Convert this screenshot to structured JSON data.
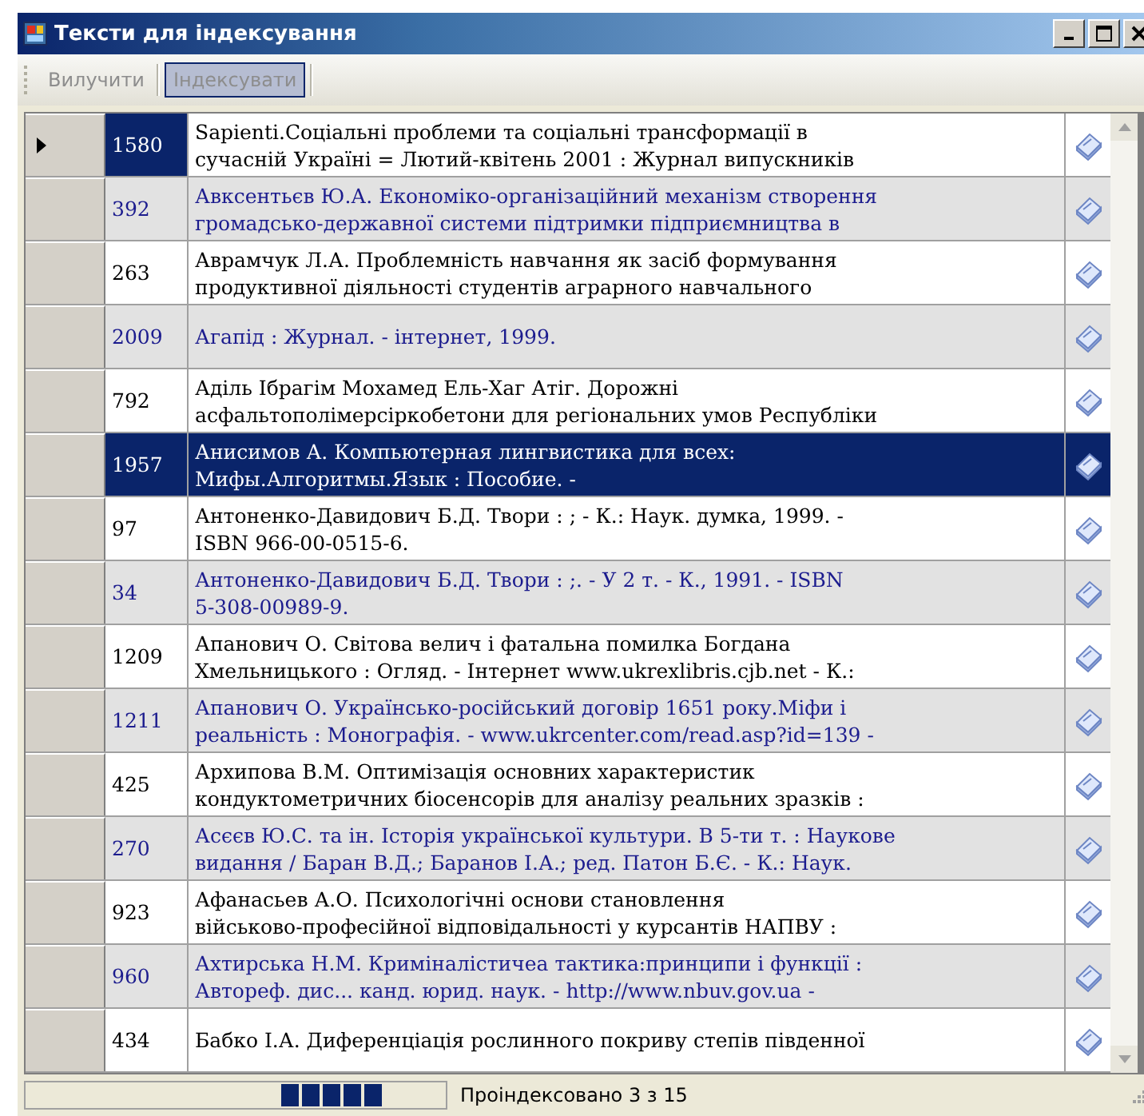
{
  "window": {
    "title": "Тексти для індексування"
  },
  "toolbar": {
    "buttons": [
      {
        "label": "Вилучити",
        "disabled": true,
        "pressed": false
      },
      {
        "label": "Індексувати",
        "disabled": true,
        "pressed": true
      }
    ]
  },
  "rows": [
    {
      "id": "1580",
      "lines": [
        "Sapienti.Соціальні проблеми та соціальні трансформації в",
        "сучасній Україні  = Лютий-квітень 2001  : Журнал випускників"
      ],
      "current": true,
      "selected": false
    },
    {
      "id": "392",
      "lines": [
        "Авксентьєв Ю.А. Економіко-організаційний механізм створення",
        "громадсько-державної системи підтримки підприємництва в"
      ],
      "current": false,
      "selected": false
    },
    {
      "id": "263",
      "lines": [
        "Аврамчук Л.А. Проблемність навчання як засіб формування",
        "продуктивної діяльності студентів аграрного навчального"
      ],
      "current": false,
      "selected": false
    },
    {
      "id": "2009",
      "lines": [
        "Агапід : Журнал. - інтернет, 1999."
      ],
      "current": false,
      "selected": false
    },
    {
      "id": "792",
      "lines": [
        "Аділь Ібрагім Мохамед Ель-Хаг Атіг.  Дорожні",
        "асфальтополімерсіркобетони для регіональних умов Республіки"
      ],
      "current": false,
      "selected": false
    },
    {
      "id": "1957",
      "lines": [
        "Анисимов А. Компьютерная лингвистика для всех:",
        "Мифы.Алгоритмы.Язык : Пособие. -"
      ],
      "current": false,
      "selected": true
    },
    {
      "id": "97",
      "lines": [
        "Антоненко-Давидович Б.Д. Твори : ; - К.: Наук. думка, 1999. -",
        "ISBN 966-00-0515-6."
      ],
      "current": false,
      "selected": false
    },
    {
      "id": "34",
      "lines": [
        "Антоненко-Давидович Б.Д. Твори : ;. - У 2 т. - К., 1991. - ISBN",
        "5-308-00989-9."
      ],
      "current": false,
      "selected": false
    },
    {
      "id": "1209",
      "lines": [
        "Апанович О. Світова велич і фатальна помилка Богдана",
        "Хмельницького : Огляд. - Інтернет www.ukrexlibris.cjb.net - К.:"
      ],
      "current": false,
      "selected": false
    },
    {
      "id": "1211",
      "lines": [
        "Апанович О. Українсько-російський договір 1651 року.Міфи і",
        "реальність : Монографія. - www.ukrcenter.com/read.asp?id=139 -"
      ],
      "current": false,
      "selected": false
    },
    {
      "id": "425",
      "lines": [
        "Архипова В.М. Оптимізація основних характеристик",
        "кондуктометричних біосенсорів для аналізу реальних зразків :"
      ],
      "current": false,
      "selected": false
    },
    {
      "id": "270",
      "lines": [
        "Асєєв Ю.С. та ін. Історія української культури. В 5-ти т. : Наукове",
        "видання / Баран В.Д.; Баранов І.А.; ред. Патон Б.Є. - К.: Наук."
      ],
      "current": false,
      "selected": false
    },
    {
      "id": "923",
      "lines": [
        "Афанасьев А.О. Психологічні основи становлення",
        "військово-професійної відповідальності у курсантів НАПВУ :"
      ],
      "current": false,
      "selected": false
    },
    {
      "id": "960",
      "lines": [
        "Ахтирська Н.М. Криміналістичеа тактика:принципи і функції :",
        "Автореф. дис... канд. юрид. наук. - http://www.nbuv.gov.ua -"
      ],
      "current": false,
      "selected": false
    },
    {
      "id": "434",
      "lines": [
        "Бабко І.А. Диференціація рослинного покриву степів південної"
      ],
      "current": false,
      "selected": false
    }
  ],
  "status_bar": {
    "text": "Проіндексовано 3 з 15"
  }
}
